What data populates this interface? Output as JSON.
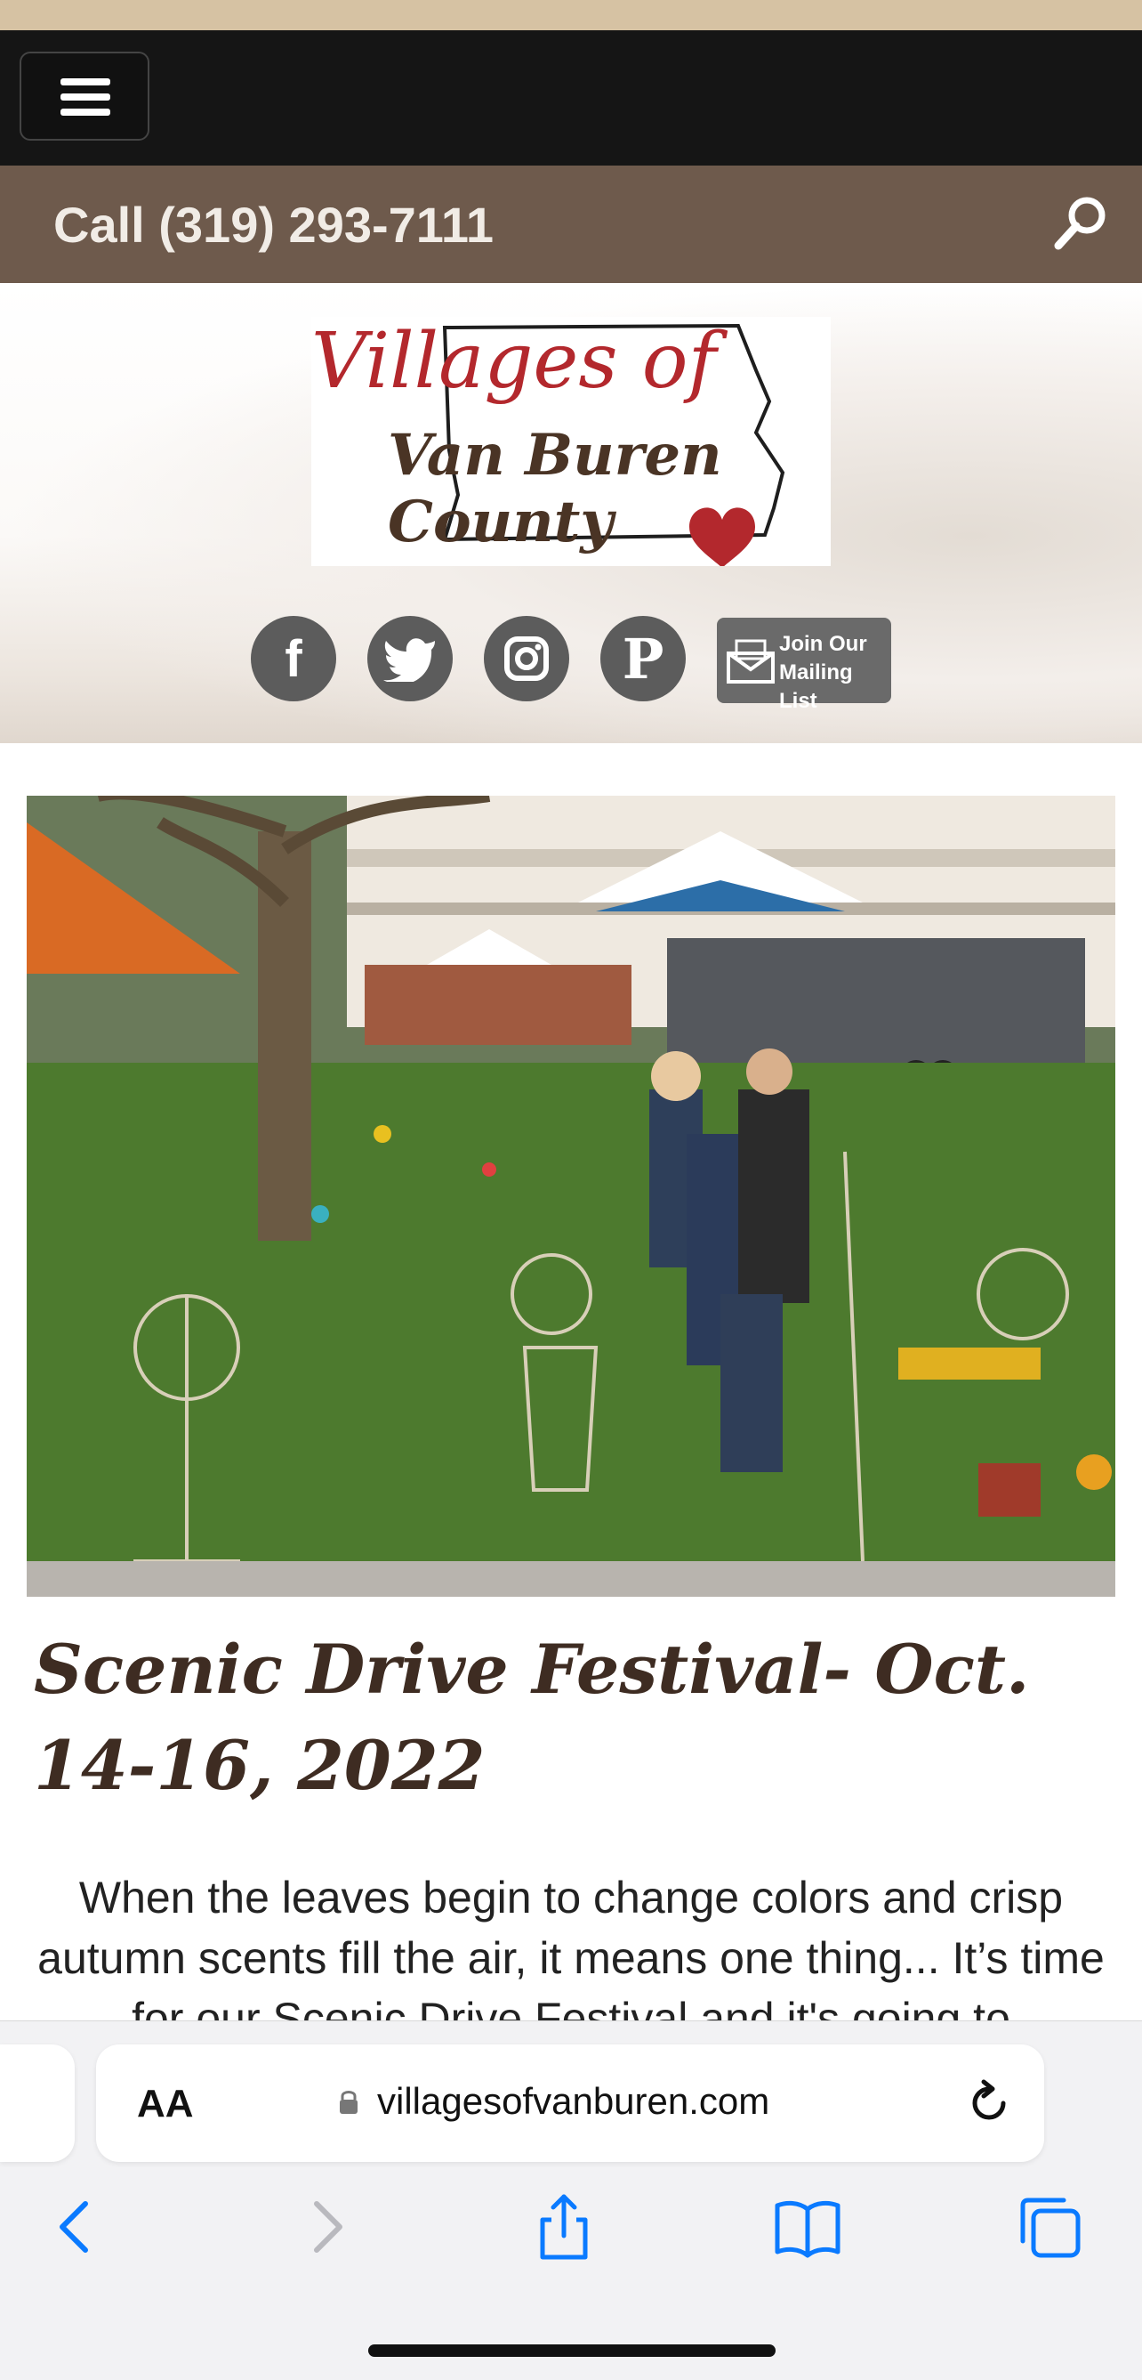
{
  "navbar": {
    "menu_icon": "hamburger-icon"
  },
  "callbar": {
    "phone_text": "Call (319) 293-7111",
    "search_icon": "search-icon"
  },
  "logo": {
    "line1": "Villages of",
    "line2": "Van Buren County"
  },
  "social": {
    "icons": [
      "facebook-icon",
      "twitter-icon",
      "instagram-icon",
      "pinterest-icon"
    ],
    "mailing_line1": "Join Our",
    "mailing_line2": "Mailing List"
  },
  "hero": {
    "description": "Outdoor craft fair with metal garden art on a lawn in front of a white hotel and tents"
  },
  "article": {
    "title": "Scenic Drive Festival- Oct. 14-16, 2022",
    "body": "When the leaves begin to change colors and crisp autumn scents fill the air, it means one thing... It’s time for our Scenic Drive Festival and it's going to"
  },
  "browser": {
    "aa_label": "AA",
    "url": "villagesofvanburen.com",
    "toolbar_icons": [
      "back-icon",
      "forward-icon",
      "share-icon",
      "bookmarks-icon",
      "tabs-icon"
    ]
  },
  "colors": {
    "brand_red": "#b3282d",
    "brand_brown": "#4a3425",
    "callbar_bg": "#6e5a4c",
    "ios_blue": "#0a7aff"
  }
}
